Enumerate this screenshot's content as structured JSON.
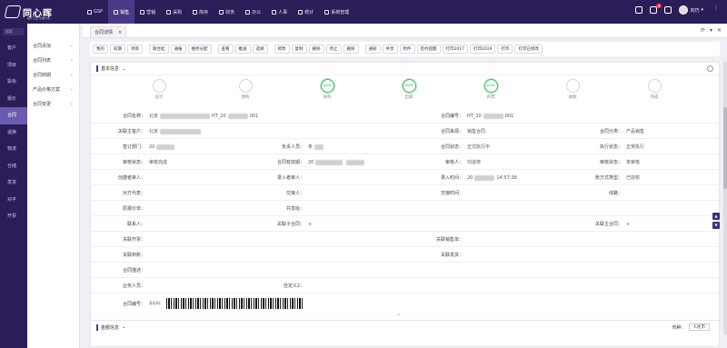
{
  "app": {
    "logo_text": "同心晖",
    "logo_sub": "医疗工业·仓储平台"
  },
  "topnav": [
    {
      "label": "GSP",
      "icon": "gsp-icon",
      "active": false
    },
    {
      "label": "销售",
      "icon": "sales-icon",
      "active": true
    },
    {
      "label": "营销",
      "icon": "marketing-icon",
      "active": false
    },
    {
      "label": "采购",
      "icon": "purchase-icon",
      "active": false
    },
    {
      "label": "库存",
      "icon": "inventory-icon",
      "active": false
    },
    {
      "label": "财务",
      "icon": "finance-icon",
      "active": false
    },
    {
      "label": "办公",
      "icon": "office-icon",
      "active": false
    },
    {
      "label": "人事",
      "icon": "hr-icon",
      "active": false
    },
    {
      "label": "统计",
      "icon": "stats-icon",
      "active": false
    },
    {
      "label": "系统管理",
      "icon": "system-icon",
      "active": false
    }
  ],
  "topright": {
    "notifications": "4",
    "username": "刘巧"
  },
  "sidebar": {
    "search_placeholder": "搜索",
    "items": [
      "客户",
      "项目",
      "投标",
      "报价",
      "合同",
      "退换",
      "物流",
      "仓储",
      "发货",
      "对平",
      "开票"
    ],
    "active_index": 4
  },
  "submenu": [
    {
      "label": "合同添加"
    },
    {
      "label": "合同列表"
    },
    {
      "label": "合同到期"
    },
    {
      "label": "产品价格方案"
    },
    {
      "label": "合同变更"
    }
  ],
  "tab": {
    "label": "合同详情"
  },
  "toolbar": [
    [
      "我的",
      "前期",
      "项目"
    ],
    [
      "联合起",
      "通报",
      "维修分配"
    ],
    [
      "查看",
      "推送",
      "选择"
    ],
    [
      "修改",
      "复制",
      "删除",
      "停止",
      "删除"
    ],
    [
      "通知",
      "共享",
      "附件",
      "签约提醒",
      "打印2017",
      "打印2019",
      "打印",
      "打印已修改"
    ]
  ],
  "panel": {
    "title": "基本信息"
  },
  "steps": [
    {
      "label": "设计",
      "done": false,
      "pct": ""
    },
    {
      "label": "预购",
      "done": false,
      "pct": ""
    },
    {
      "label": "采购",
      "done": true,
      "pct": "100%"
    },
    {
      "label": "出库",
      "done": true,
      "pct": "100%"
    },
    {
      "label": "开票",
      "done": true,
      "pct": "100%"
    },
    {
      "label": "收款",
      "done": false,
      "pct": ""
    },
    {
      "label": "完成",
      "done": false,
      "pct": ""
    }
  ],
  "form": {
    "contract_name_label": "合同名称：",
    "contract_name_prefix": "北京",
    "contract_name_mid": "HT_20",
    "contract_name_suffix": "001",
    "contract_no_label": "合同编号：",
    "contract_no_prefix": "HT_20",
    "contract_no_suffix": "001",
    "related_customer_label": "关联主客户：",
    "related_customer_value": "北京",
    "contract_source_label": "合同来源：",
    "contract_source_value": "销售合同",
    "contract_cat_label": "合同分类：",
    "contract_cat_value": "产品销售",
    "sign_dept_label": "签订部门：",
    "sign_dept_value": "20",
    "manager_label": "负责人员：",
    "manager_value": "朱",
    "contract_status_label": "合同状态：",
    "contract_status_value": "正式执行中",
    "exec_status_label": "执行状态：",
    "exec_status_value": "正常执行",
    "approval_label": "审核状态：",
    "approval_value": "审核完成",
    "contract_date_label": "合同有效期：",
    "contract_date_value": "20",
    "reviewer_label": "审核人：",
    "reviewer_value": "刘进修",
    "audit_status_label": "审核状态：",
    "audit_status_value": "未审核",
    "creator_label": "创建者审人：",
    "entry_label": "录入者审人：",
    "entry_time_label": "录入时间：",
    "entry_time_value": "20",
    "entry_time_suffix": "14:57:38",
    "pay_type_label": "账方式类型：",
    "pay_type_value": "已授权",
    "invoice_label": "对方代表：",
    "handover_label": "交接人：",
    "handover_time_label": "交接时间：",
    "route_label": "线路：",
    "quote_label": "原报价单：",
    "share_label": "共享给：",
    "contact_label": "联系人：",
    "link_contract_label": "关联子合同：",
    "plus": "+",
    "link_main_label": "关联主合同：",
    "plus2": "+",
    "link_invoice_label": "关联开票：",
    "link_sales_label": "关联销售单：",
    "link_invoice2_label": "关联到账：",
    "link_ship_label": "关联发货：",
    "contract_desc_label": "合同描述：",
    "business_label": "业务人员：",
    "custom_label": "自定义2：",
    "barcode_label": "合同编号：",
    "barcode_sub": "条形码："
  },
  "panel2": {
    "title": "金额信息",
    "currency_label": "币种：",
    "currency_value": "人民币"
  }
}
